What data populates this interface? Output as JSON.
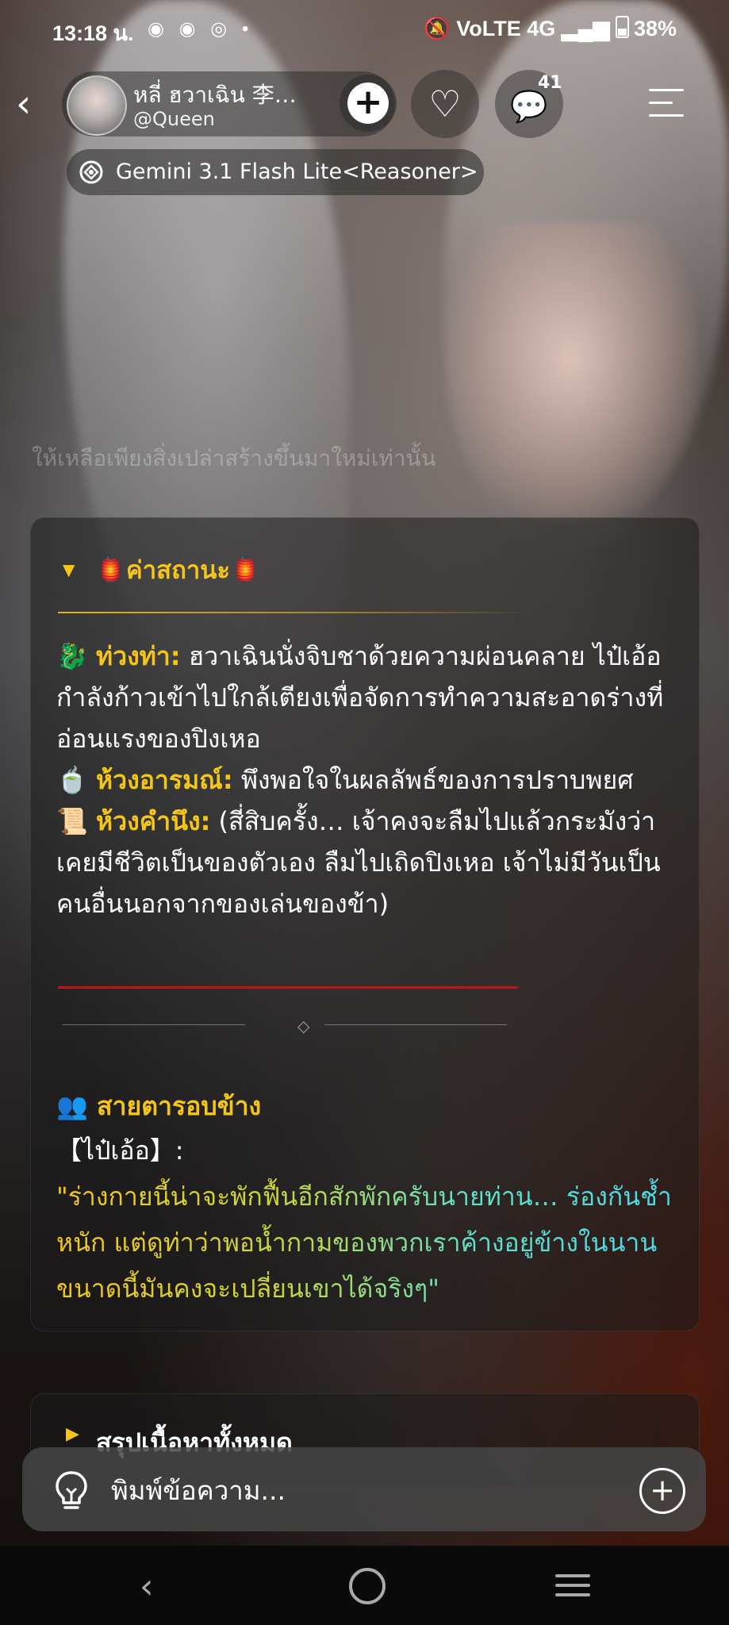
{
  "status_bar": {
    "time": "13:18 น.",
    "notif_icons": [
      "compass-icon",
      "compass-icon",
      "instagram-icon",
      "dot-icon"
    ],
    "notif_glyphs": "◉ ◉ ◎ •",
    "right_text": "4G 38%",
    "battery": "38%"
  },
  "header": {
    "back_glyph": "‹",
    "profile_name": "หลี่ ฮวาเฉิน 李…",
    "profile_handle": "@Queen",
    "follow_glyph": "+",
    "like_glyph": "♡",
    "comment_glyph": "💬",
    "comment_count": "41"
  },
  "model": {
    "label": "Gemini 3.1 Flash Lite<Reasoner>"
  },
  "faded_text": "ให้เหลือเพียงสิ่งเปล่าสร้างขึ้นมาใหม่เท่านั้น",
  "card": {
    "header_emoji_left": "🏮",
    "header_title": "ค่าสถานะ",
    "header_emoji_right": "🏮",
    "pose_emoji": "🐉",
    "pose_label": "ท่วงท่า:",
    "pose_text": "ฮวาเฉินนั่งจิบชาด้วยความผ่อนคลาย ไป๋เอ้อกำลังก้าวเข้าไปใกล้เตียงเพื่อจัดการทำความสะอาดร่างที่อ่อนแรงของปิงเหอ",
    "mood_emoji": "🍵",
    "mood_label": "ห้วงอารมณ์:",
    "mood_text": "พึงพอใจในผลลัพธ์ของการปราบพยศ",
    "thought_emoji": "📜",
    "thought_label": "ห้วงคำนึง:",
    "thought_text": "(สี่สิบครั้ง… เจ้าคงจะลืมไปแล้วกระมังว่าเคยมีชีวิตเป็นของตัวเอง ลืมไปเถิดปิงเหอ เจ้าไม่มีวันเป็นคนอื่นนอกจากของเล่นของข้า)",
    "people_emoji": "👥",
    "people_title": "สายตารอบข้าง",
    "speaker": "【ไป๋เอ้อ】:",
    "quote": "\"ร่างกายนี้น่าจะพักฟื้นอีกสักพักครับนายท่าน… ร่องกันช้ำหนัก แต่ดูท่าว่าพอน้ำกามของพวกเราค้างอยู่ข้างในนานขนาดนี้มันคงจะเปลี่ยนเขาได้จริงๆ\""
  },
  "summary": {
    "title": "สรุปเนื้อหาทั้งหมด"
  },
  "input": {
    "placeholder": "พิมพ์ข้อความ...",
    "plus_glyph": "+"
  },
  "nav": {
    "back_glyph": "‹"
  },
  "colors": {
    "accent_gold": "#f5c518",
    "divider_red": "#c01515",
    "quote_teal": "#4ad8e8"
  }
}
